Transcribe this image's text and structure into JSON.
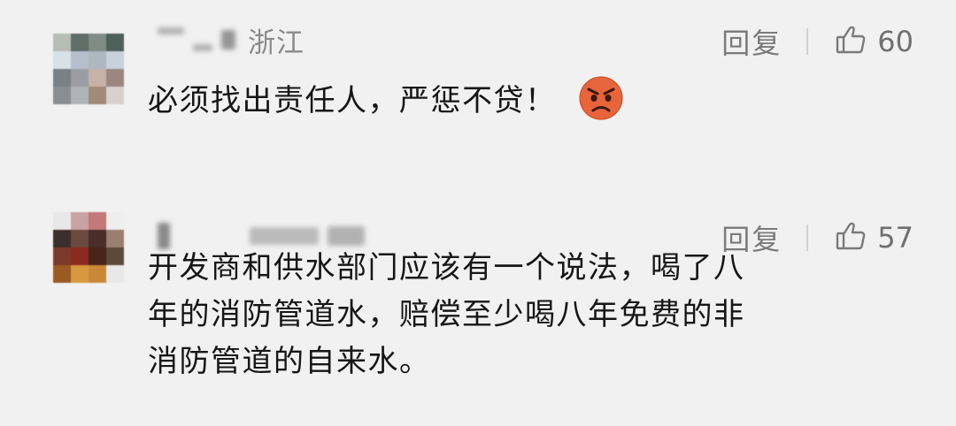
{
  "comments": [
    {
      "username_suffix": "浙江",
      "reply_label": "回复",
      "like_count": "60",
      "content_lines": [
        "必须找出责任人，严惩不贷！"
      ],
      "emoji": "angry-face-emoji"
    },
    {
      "username_suffix": "",
      "reply_label": "回复",
      "like_count": "57",
      "content_lines": [
        "开发商和供水部门应该有一个说法，喝了八",
        "年的消防管道水，赔偿至少喝八年免费的非",
        "消防管道的自来水。"
      ]
    }
  ],
  "colors": {
    "background": "#f1f1f1",
    "text": "#161616",
    "secondary": "#7a7a7a",
    "emoji_face": "#e8643a"
  },
  "icons": {
    "like": "thumbs-up-icon",
    "emoji": "angry-face-emoji"
  }
}
